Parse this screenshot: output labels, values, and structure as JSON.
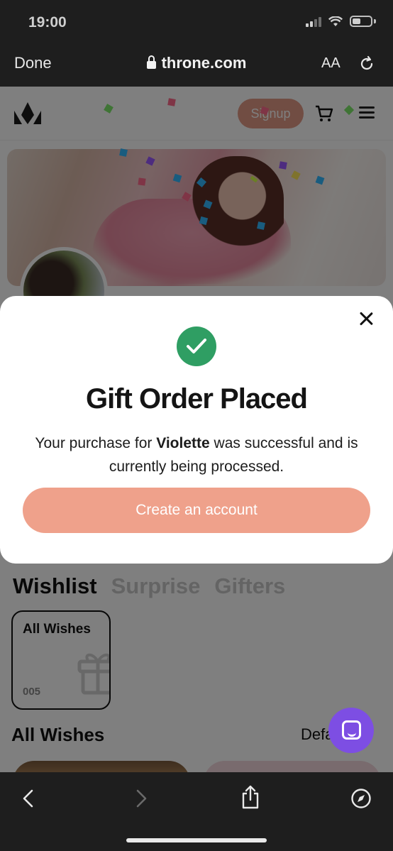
{
  "status_bar": {
    "time": "19:00"
  },
  "safari": {
    "done_label": "Done",
    "url": "throne.com",
    "text_size_label": "AA"
  },
  "site": {
    "signup_label": "Signup",
    "tabs": [
      {
        "label": "Wishlist",
        "active": true
      },
      {
        "label": "Surprise",
        "active": false
      },
      {
        "label": "Gifters",
        "active": false
      }
    ],
    "wish_card": {
      "title": "All Wishes",
      "count": "005"
    },
    "all_wishes_title": "All Wishes",
    "sort_label": "Defa"
  },
  "modal": {
    "title": "Gift Order Placed",
    "message_prefix": "Your purchase for ",
    "recipient": "Violette",
    "message_suffix": " was successful and is currently being processed.",
    "create_account_label": "Create an account"
  },
  "colors": {
    "accent": "#efa18b",
    "success": "#2f9e63",
    "chat_fab": "#7d4ee3"
  },
  "icons": [
    "lock-icon",
    "reload-icon",
    "logo-icon",
    "cart-icon",
    "menu-icon",
    "gift-icon",
    "close-icon",
    "check-icon",
    "chat-icon",
    "back-icon",
    "forward-icon",
    "share-icon",
    "compass-icon"
  ]
}
